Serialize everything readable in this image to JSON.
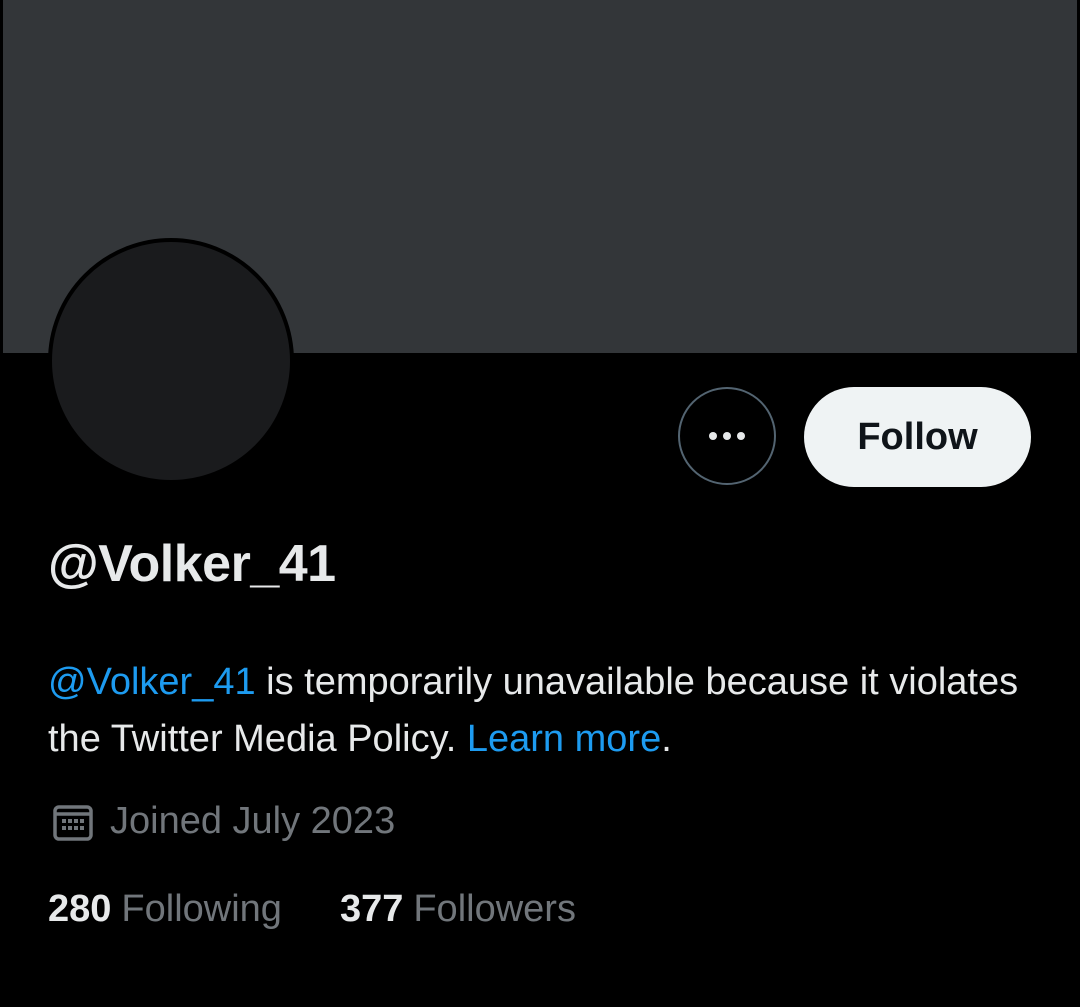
{
  "profile": {
    "handle": "@Volker_41",
    "follow_label": "Follow",
    "notice": {
      "mention": "@Volker_41",
      "text_1": " is temporarily unavailable because it violates the Twitter Media Policy. ",
      "learn_more": "Learn more",
      "text_2": "."
    },
    "joined": "Joined July 2023",
    "stats": {
      "following_count": "280",
      "following_label": "Following",
      "followers_count": "377",
      "followers_label": "Followers"
    }
  },
  "icons": {
    "more": "more-horizontal-icon",
    "calendar": "calendar-icon"
  },
  "colors": {
    "background": "#000000",
    "banner": "#333639",
    "link": "#1d9bf0",
    "secondary_text": "#71767b",
    "primary_text": "#e7e9ea",
    "follow_button_bg": "#eff3f4"
  }
}
